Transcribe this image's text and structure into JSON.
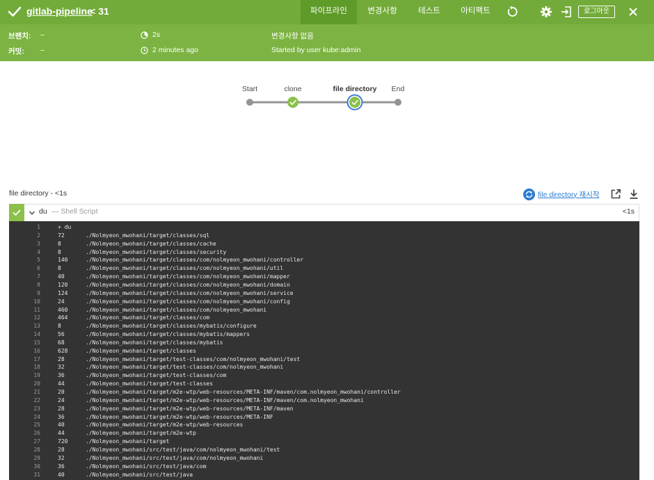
{
  "header": {
    "job_name": "gitlab-pipeline",
    "run_number": "31",
    "tabs": [
      {
        "label": "파이프라인",
        "active": true
      },
      {
        "label": "변경사항",
        "active": false
      },
      {
        "label": "테스트",
        "active": false
      },
      {
        "label": "아티팩트",
        "active": false
      }
    ],
    "logout_label": "로그아웃",
    "icons": [
      "check-icon",
      "replay-icon",
      "gear-icon",
      "exit-icon",
      "close-icon"
    ]
  },
  "info": {
    "branch_label": "브랜치:",
    "branch_value": "–",
    "commit_label": "커밋:",
    "commit_value": "–",
    "duration": "2s",
    "started_ago": "2 minutes ago",
    "changes": "변경사항 없음",
    "started_by": "Started by user kube:admin"
  },
  "pipeline": {
    "stages": [
      {
        "label": "Start",
        "status": "none"
      },
      {
        "label": "clone",
        "status": "success"
      },
      {
        "label": "file directory",
        "status": "success",
        "selected": true
      },
      {
        "label": "End",
        "status": "none"
      }
    ]
  },
  "stage_detail": {
    "title": "file directory - <1s",
    "restart_label": "file directory 재시작",
    "step": {
      "name": "du",
      "description": "— Shell Script",
      "duration": "<1s"
    }
  },
  "log": {
    "command": "+ du",
    "lines": [
      {
        "size": "72",
        "path": "./Nolmyeon_mwohani/target/classes/sql"
      },
      {
        "size": "8",
        "path": "./Nolmyeon_mwohani/target/classes/cache"
      },
      {
        "size": "8",
        "path": "./Nolmyeon_mwohani/target/classes/security"
      },
      {
        "size": "140",
        "path": "./Nolmyeon_mwohani/target/classes/com/nolmyeon_mwohani/controller"
      },
      {
        "size": "8",
        "path": "./Nolmyeon_mwohani/target/classes/com/nolmyeon_mwohani/util"
      },
      {
        "size": "40",
        "path": "./Nolmyeon_mwohani/target/classes/com/nolmyeon_mwohani/mapper"
      },
      {
        "size": "120",
        "path": "./Nolmyeon_mwohani/target/classes/com/nolmyeon_mwohani/domain"
      },
      {
        "size": "124",
        "path": "./Nolmyeon_mwohani/target/classes/com/nolmyeon_mwohani/service"
      },
      {
        "size": "24",
        "path": "./Nolmyeon_mwohani/target/classes/com/nolmyeon_mwohani/config"
      },
      {
        "size": "460",
        "path": "./Nolmyeon_mwohani/target/classes/com/nolmyeon_mwohani"
      },
      {
        "size": "464",
        "path": "./Nolmyeon_mwohani/target/classes/com"
      },
      {
        "size": "8",
        "path": "./Nolmyeon_mwohani/target/classes/mybatis/configure"
      },
      {
        "size": "56",
        "path": "./Nolmyeon_mwohani/target/classes/mybatis/mappers"
      },
      {
        "size": "68",
        "path": "./Nolmyeon_mwohani/target/classes/mybatis"
      },
      {
        "size": "628",
        "path": "./Nolmyeon_mwohani/target/classes"
      },
      {
        "size": "28",
        "path": "./Nolmyeon_mwohani/target/test-classes/com/nolmyeon_mwohani/test"
      },
      {
        "size": "32",
        "path": "./Nolmyeon_mwohani/target/test-classes/com/nolmyeon_mwohani"
      },
      {
        "size": "36",
        "path": "./Nolmyeon_mwohani/target/test-classes/com"
      },
      {
        "size": "44",
        "path": "./Nolmyeon_mwohani/target/test-classes"
      },
      {
        "size": "20",
        "path": "./Nolmyeon_mwohani/target/m2e-wtp/web-resources/META-INF/maven/com.nolmyeon_mwohani/controller"
      },
      {
        "size": "24",
        "path": "./Nolmyeon_mwohani/target/m2e-wtp/web-resources/META-INF/maven/com.nolmyeon_mwohani"
      },
      {
        "size": "28",
        "path": "./Nolmyeon_mwohani/target/m2e-wtp/web-resources/META-INF/maven"
      },
      {
        "size": "36",
        "path": "./Nolmyeon_mwohani/target/m2e-wtp/web-resources/META-INF"
      },
      {
        "size": "40",
        "path": "./Nolmyeon_mwohani/target/m2e-wtp/web-resources"
      },
      {
        "size": "44",
        "path": "./Nolmyeon_mwohani/target/m2e-wtp"
      },
      {
        "size": "720",
        "path": "./Nolmyeon_mwohani/target"
      },
      {
        "size": "28",
        "path": "./Nolmyeon_mwohani/src/test/java/com/nolmyeon_mwohani/test"
      },
      {
        "size": "32",
        "path": "./Nolmyeon_mwohani/src/test/java/com/nolmyeon_mwohani"
      },
      {
        "size": "36",
        "path": "./Nolmyeon_mwohani/src/test/java/com"
      },
      {
        "size": "40",
        "path": "./Nolmyeon_mwohani/src/test/java"
      }
    ]
  },
  "colors": {
    "header_green": "#72ab39",
    "active_tab": "#5e9b28",
    "info_green": "#7cb342",
    "success": "#8cc04b",
    "pending": "#949494",
    "link": "#2b7bd1",
    "console_bg": "#333333"
  }
}
